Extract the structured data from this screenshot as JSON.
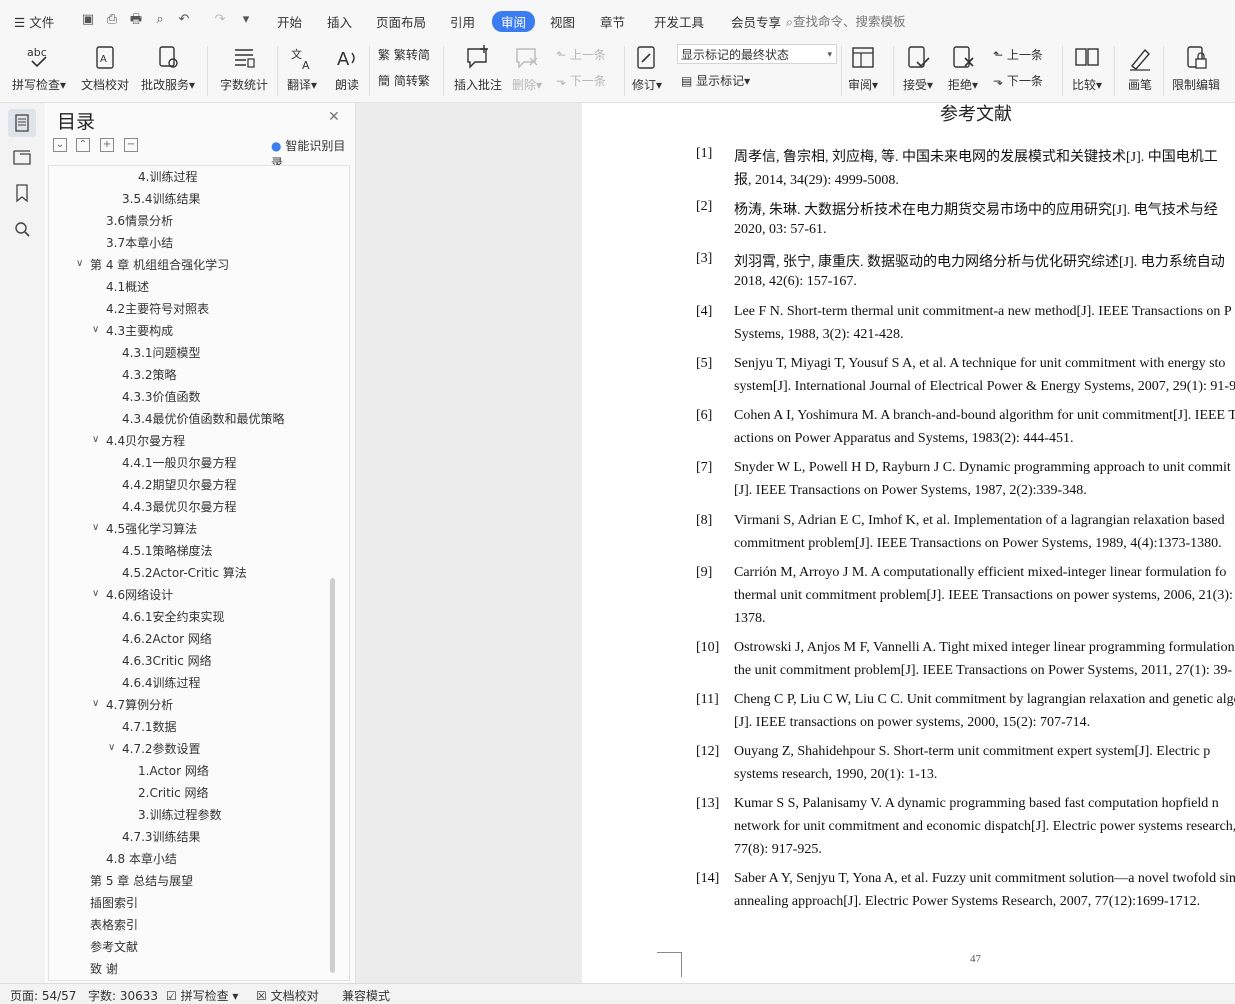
{
  "menubar": {
    "file_label": "文件",
    "tabs": [
      "开始",
      "插入",
      "页面布局",
      "引用",
      "审阅",
      "视图",
      "章节",
      "开发工具",
      "会员专享"
    ],
    "active_tab": "审阅",
    "search_placeholder": "查找命令、搜索模板"
  },
  "ribbon": {
    "spell_check": "拼写检查",
    "doc_proof": "文档校对",
    "batch_service": "批改服务",
    "word_count": "字数统计",
    "translate": "翻译",
    "read_aloud": "朗读",
    "trad_to_simp": "繁转简",
    "simp_to_trad": "简转繁",
    "insert_comment": "插入批注",
    "delete": "删除",
    "prev_comment": "上一条",
    "next_comment": "下一条",
    "track_changes": "修订",
    "markup_state": "显示标记的最终状态",
    "show_markup": "显示标记",
    "review": "审阅",
    "accept": "接受",
    "reject": "拒绝",
    "prev_change": "上一条",
    "next_change": "下一条",
    "compare": "比较",
    "pen": "画笔",
    "restrict_edit": "限制编辑"
  },
  "toc": {
    "title": "目录",
    "smart_toc": "智能识别目录",
    "items": [
      "4.训练过程",
      "3.5.4训练结果",
      "3.6情景分析",
      "3.7本章小结",
      "第 4 章  机组组合强化学习",
      "4.1概述",
      "4.2主要符号对照表",
      "4.3主要构成",
      "4.3.1问题模型",
      "4.3.2策略",
      "4.3.3价值函数",
      "4.3.4最优价值函数和最优策略",
      "4.4贝尔曼方程",
      "4.4.1一般贝尔曼方程",
      "4.4.2期望贝尔曼方程",
      "4.4.3最优贝尔曼方程",
      "4.5强化学习算法",
      "4.5.1策略梯度法",
      "4.5.2Actor-Critic 算法",
      "4.6网络设计",
      "4.6.1安全约束实现",
      "4.6.2Actor 网络",
      "4.6.3Critic 网络",
      "4.6.4训练过程",
      "4.7算例分析",
      "4.7.1数据",
      "4.7.2参数设置",
      "1.Actor 网络",
      "2.Critic 网络",
      "3.训练过程参数",
      "4.7.3训练结果",
      "4.8  本章小结",
      "第 5 章  总结与展望",
      "插图索引",
      "表格索引",
      "参考文献",
      "致  谢"
    ]
  },
  "document": {
    "heading": "参考文献",
    "page_number": "47",
    "refs": [
      {
        "num": "[1]",
        "lines": [
          "周孝信, 鲁宗相, 刘应梅, 等. 中国未来电网的发展模式和关键技术[J]. 中国电机工",
          "报, 2014, 34(29): 4999-5008."
        ]
      },
      {
        "num": "[2]",
        "lines": [
          "杨涛, 朱琳. 大数据分析技术在电力期货交易市场中的应用研究[J]. 电气技术与经",
          "2020, 03: 57-61."
        ]
      },
      {
        "num": "[3]",
        "lines": [
          "刘羽霄, 张宁, 康重庆. 数据驱动的电力网络分析与优化研究综述[J]. 电力系统自动",
          "2018, 42(6): 157-167."
        ]
      },
      {
        "num": "[4]",
        "lines": [
          "Lee F N. Short-term thermal unit commitment-a new method[J]. IEEE Transactions on P",
          "Systems, 1988, 3(2): 421-428."
        ]
      },
      {
        "num": "[5]",
        "lines": [
          "Senjyu T, Miyagi T, Yousuf S A, et al. A technique for unit commitment with energy sto",
          "system[J]. International Journal of Electrical Power & Energy Systems, 2007, 29(1): 91-9"
        ]
      },
      {
        "num": "[6]",
        "lines": [
          "Cohen A I, Yoshimura M. A branch-and-bound algorithm for unit commitment[J]. IEEE T",
          "actions on Power Apparatus and Systems, 1983(2): 444-451."
        ]
      },
      {
        "num": "[7]",
        "lines": [
          "Snyder W L, Powell H D, Rayburn J C. Dynamic programming approach to unit commit",
          "[J]. IEEE Transactions on Power Systems, 1987, 2(2):339-348."
        ]
      },
      {
        "num": "[8]",
        "lines": [
          "Virmani S, Adrian E C, Imhof K, et al. Implementation of a lagrangian relaxation based",
          "commitment problem[J]. IEEE Transactions on Power Systems, 1989, 4(4):1373-1380."
        ]
      },
      {
        "num": "[9]",
        "lines": [
          "Carrión M, Arroyo J M. A computationally efficient mixed-integer linear formulation fo",
          "thermal unit commitment problem[J]. IEEE Transactions on power systems, 2006, 21(3): 1",
          "1378."
        ]
      },
      {
        "num": "[10]",
        "lines": [
          "Ostrowski J, Anjos M F, Vannelli A. Tight mixed integer linear programming formulation",
          "the unit commitment problem[J]. IEEE Transactions on Power Systems, 2011, 27(1): 39-"
        ]
      },
      {
        "num": "[11]",
        "lines": [
          "Cheng C P, Liu C W, Liu C C. Unit commitment by lagrangian relaxation and genetic algor",
          "[J]. IEEE transactions on power systems, 2000, 15(2): 707-714."
        ]
      },
      {
        "num": "[12]",
        "lines": [
          "Ouyang Z, Shahidehpour S. Short-term unit commitment expert system[J]. Electric p",
          "systems research, 1990, 20(1): 1-13."
        ]
      },
      {
        "num": "[13]",
        "lines": [
          "Kumar S S, Palanisamy V. A dynamic programming based fast computation hopfield n",
          "network for unit commitment and economic dispatch[J]. Electric power systems research,",
          "77(8): 917-925."
        ]
      },
      {
        "num": "[14]",
        "lines": [
          "Saber A Y, Senjyu T, Yona A, et al. Fuzzy unit commitment solution—a novel twofold simu",
          "annealing approach[J]. Electric Power Systems Research, 2007, 77(12):1699-1712."
        ]
      }
    ]
  },
  "status": {
    "page": "页面: 54/57",
    "words": "字数: 30633",
    "spell_check": "拼写检查",
    "doc_proof": "文档校对",
    "compat_mode": "兼容模式"
  },
  "colors": {
    "accent": "#3b7cf0",
    "disabled": "#b8b8b8"
  }
}
